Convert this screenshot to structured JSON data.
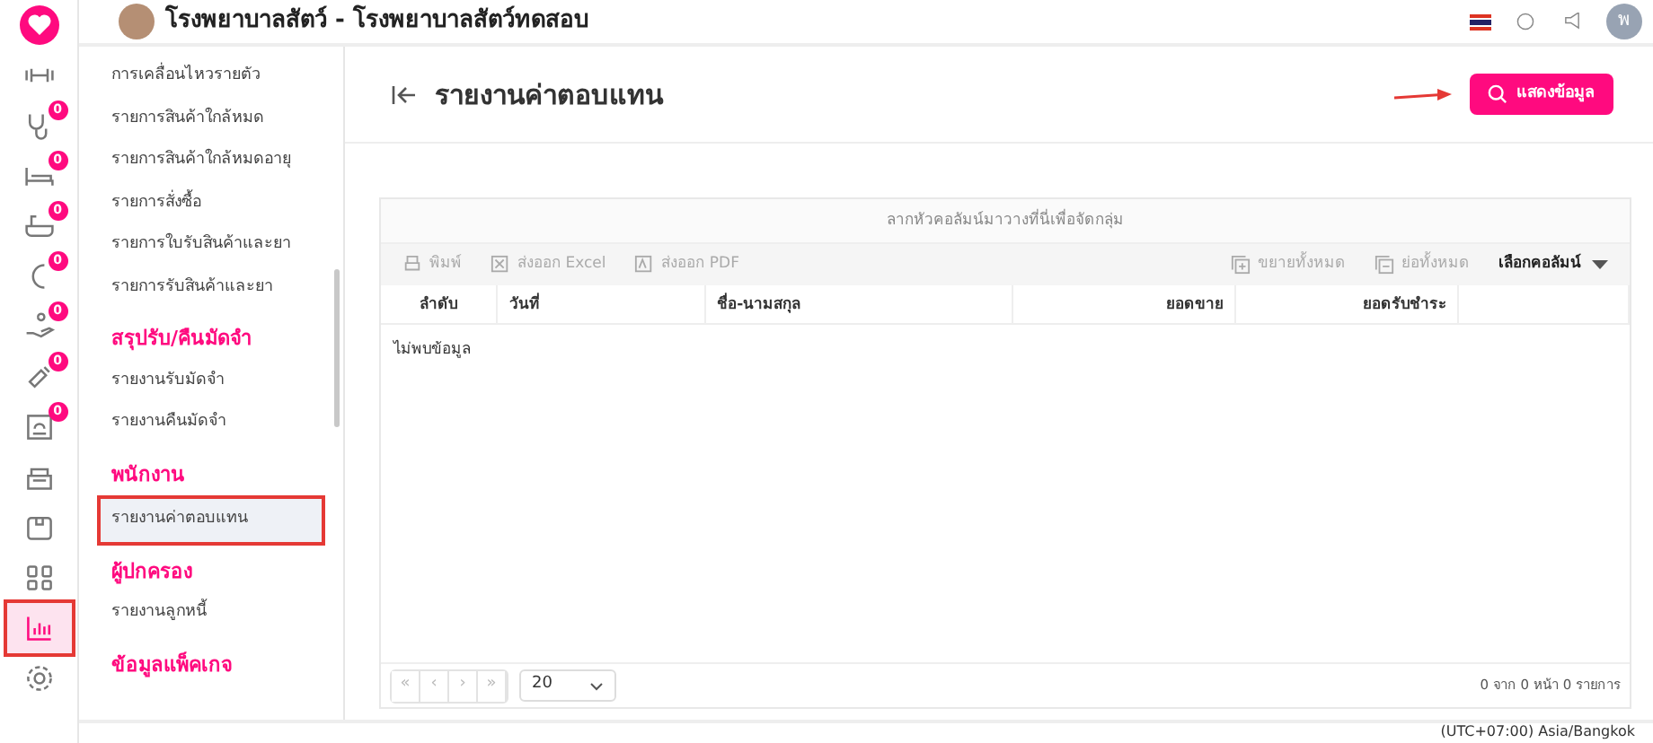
{
  "header": {
    "title": "โรงพยาบาลสัตว์ - โรงพยาบาลสัตว์ทดสอบ",
    "avatar_initial": "พ"
  },
  "rail": [
    {
      "kind": "logo",
      "selected": false
    },
    {
      "kind": "dumbbell",
      "selected": false
    },
    {
      "kind": "stethoscope",
      "badge": "0",
      "selected": false
    },
    {
      "kind": "bed",
      "badge": "0",
      "selected": false
    },
    {
      "kind": "bath",
      "badge": "0",
      "selected": false
    },
    {
      "kind": "moon",
      "badge": "0",
      "selected": false
    },
    {
      "kind": "hand",
      "badge": "0",
      "selected": false
    },
    {
      "kind": "syringe",
      "badge": "0",
      "selected": false
    },
    {
      "kind": "cage",
      "badge": "0",
      "selected": false
    },
    {
      "kind": "register",
      "selected": false
    },
    {
      "kind": "box",
      "selected": false
    },
    {
      "kind": "grid",
      "selected": false
    },
    {
      "kind": "chart",
      "selected": true
    },
    {
      "kind": "gear",
      "selected": false
    }
  ],
  "sidebar": [
    {
      "kind": "item",
      "label": "การเคลื่อนไหวรายตัว",
      "selected": false
    },
    {
      "kind": "item",
      "label": "รายการสินค้าใกล้หมด",
      "selected": false
    },
    {
      "kind": "item",
      "label": "รายการสินค้าใกล้หมดอายุ",
      "selected": false
    },
    {
      "kind": "item",
      "label": "รายการสั่งซื้อ",
      "selected": false
    },
    {
      "kind": "item",
      "label": "รายการใบรับสินค้าและยา",
      "selected": false
    },
    {
      "kind": "item",
      "label": "รายการรับสินค้าและยา",
      "selected": false
    },
    {
      "kind": "heading",
      "label": "สรุปรับ/คืนมัดจำ"
    },
    {
      "kind": "item",
      "label": "รายงานรับมัดจำ",
      "selected": false
    },
    {
      "kind": "item",
      "label": "รายงานคืนมัดจำ",
      "selected": false
    },
    {
      "kind": "heading",
      "label": "พนักงาน"
    },
    {
      "kind": "item",
      "label": "รายงานค่าตอบแทน",
      "selected": true
    },
    {
      "kind": "heading",
      "label": "ผู้ปกครอง"
    },
    {
      "kind": "item",
      "label": "รายงานลูกหนี้",
      "selected": false
    },
    {
      "kind": "heading",
      "label": "ข้อมูลแพ็คเกจ"
    }
  ],
  "page": {
    "title": "รายงานค่าตอบแทน",
    "show_button": "แสดงข้อมูล"
  },
  "grid": {
    "group_panel": "ลากหัวคอลัมน์มาวางที่นี่เพื่อจัดกลุ่ม",
    "toolbar_left": [
      {
        "kind": "print",
        "label": "พิมพ์"
      },
      {
        "kind": "excel",
        "label": "ส่งออก Excel"
      },
      {
        "kind": "pdf",
        "label": "ส่งออก PDF"
      }
    ],
    "toolbar_right": [
      {
        "kind": "expand",
        "label": "ขยายทั้งหมด"
      },
      {
        "kind": "collapse",
        "label": "ย่อทั้งหมด"
      }
    ],
    "column_chooser": "เลือกคอลัมน์",
    "columns": [
      {
        "label": "ลำดับ"
      },
      {
        "label": "วันที่"
      },
      {
        "label": "ชื่อ-นามสกุล"
      },
      {
        "label": "ยอดขาย"
      },
      {
        "label": "ยอดรับชำระ"
      },
      {}
    ],
    "empty_text": "ไม่พบข้อมูล",
    "pager": [
      "«",
      "‹",
      "›",
      "»"
    ],
    "page_size": "20",
    "summary": "0 จาก 0 หน้า 0 รายการ"
  },
  "footer": {
    "timezone": "(UTC+07:00) Asia/Bangkok"
  }
}
